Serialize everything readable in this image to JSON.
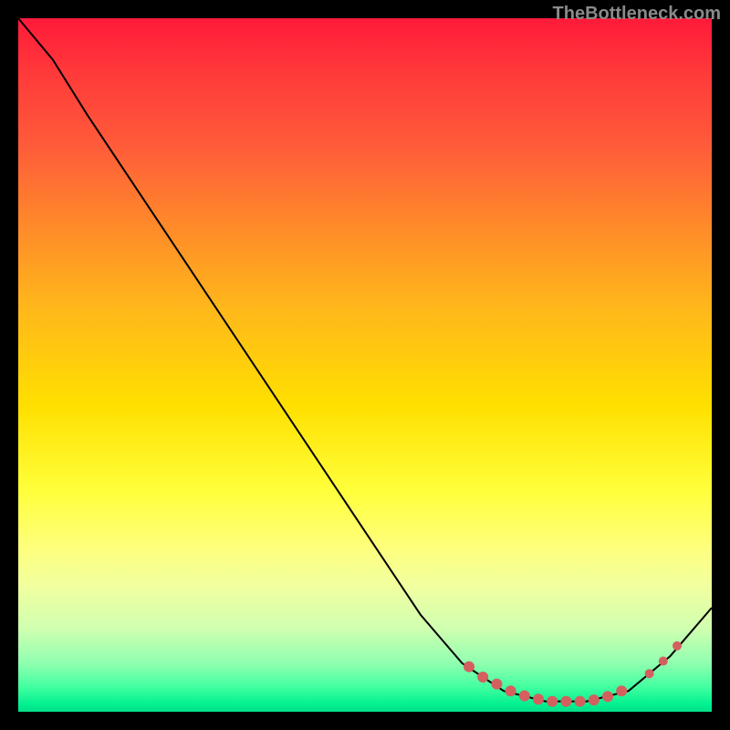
{
  "watermark": "TheBottleneck.com",
  "chart_data": {
    "type": "line",
    "title": "",
    "xlabel": "",
    "ylabel": "",
    "xlim": [
      0,
      100
    ],
    "ylim": [
      0,
      100
    ],
    "series": [
      {
        "name": "curve",
        "points": [
          {
            "x": 0,
            "y": 100
          },
          {
            "x": 5,
            "y": 94
          },
          {
            "x": 10,
            "y": 86
          },
          {
            "x": 20,
            "y": 71
          },
          {
            "x": 30,
            "y": 56
          },
          {
            "x": 40,
            "y": 41
          },
          {
            "x": 50,
            "y": 26
          },
          {
            "x": 58,
            "y": 14
          },
          {
            "x": 64,
            "y": 7
          },
          {
            "x": 70,
            "y": 3
          },
          {
            "x": 76,
            "y": 1.5
          },
          {
            "x": 82,
            "y": 1.5
          },
          {
            "x": 88,
            "y": 3
          },
          {
            "x": 94,
            "y": 8
          },
          {
            "x": 100,
            "y": 15
          }
        ]
      }
    ],
    "markers": [
      {
        "x": 65,
        "y": 6.5,
        "r": 6
      },
      {
        "x": 67,
        "y": 5,
        "r": 6
      },
      {
        "x": 69,
        "y": 4,
        "r": 6
      },
      {
        "x": 71,
        "y": 3,
        "r": 6
      },
      {
        "x": 73,
        "y": 2.3,
        "r": 6
      },
      {
        "x": 75,
        "y": 1.8,
        "r": 6
      },
      {
        "x": 77,
        "y": 1.5,
        "r": 6
      },
      {
        "x": 79,
        "y": 1.5,
        "r": 6
      },
      {
        "x": 81,
        "y": 1.5,
        "r": 6
      },
      {
        "x": 83,
        "y": 1.7,
        "r": 6
      },
      {
        "x": 85,
        "y": 2.2,
        "r": 6
      },
      {
        "x": 87,
        "y": 3,
        "r": 6
      },
      {
        "x": 91,
        "y": 5.5,
        "r": 5
      },
      {
        "x": 93,
        "y": 7.3,
        "r": 5
      },
      {
        "x": 95,
        "y": 9.5,
        "r": 5
      }
    ],
    "gradient_stops": [
      {
        "pos": 0,
        "color": "#ff1a3a"
      },
      {
        "pos": 50,
        "color": "#ffe000"
      },
      {
        "pos": 95,
        "color": "#40ffa0"
      },
      {
        "pos": 100,
        "color": "#00e088"
      }
    ]
  }
}
